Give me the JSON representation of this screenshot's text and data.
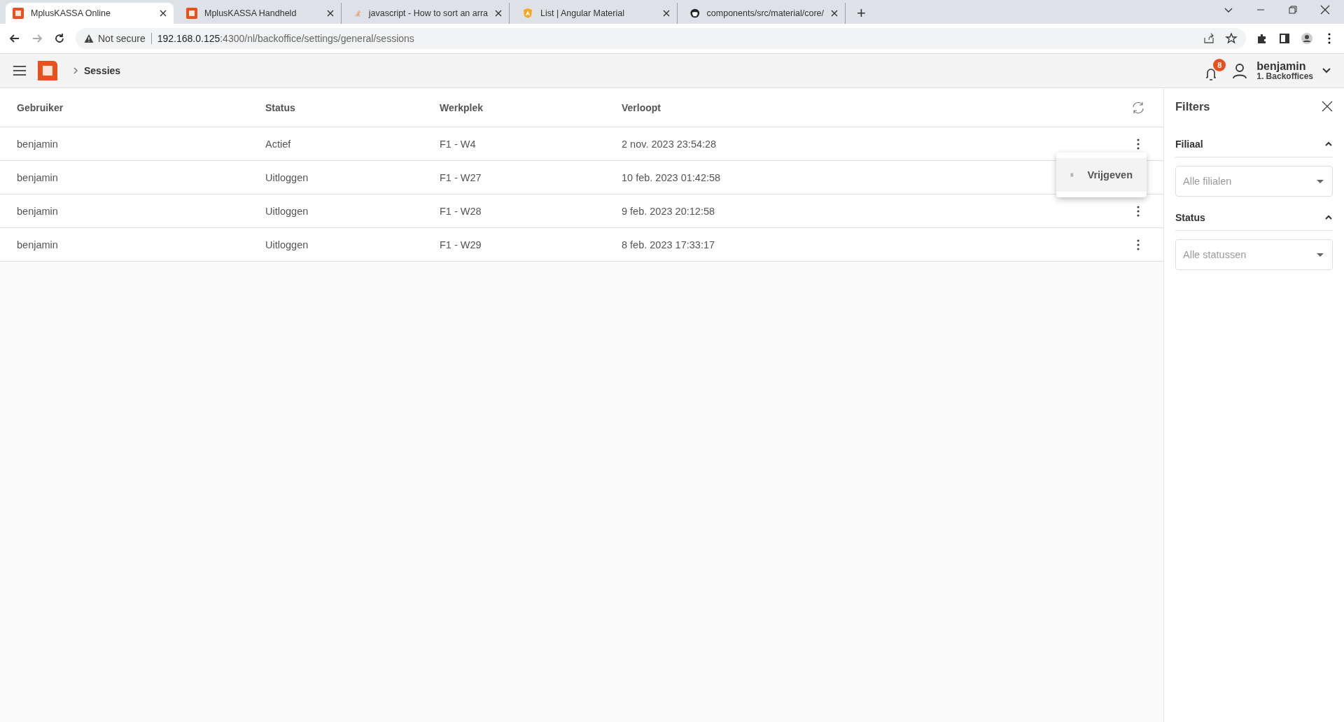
{
  "browser": {
    "tabs": [
      {
        "title": "MplusKASSA Online",
        "selected": true,
        "kind": "mplus"
      },
      {
        "title": "MplusKASSA Handheld",
        "selected": false,
        "kind": "mplus"
      },
      {
        "title": "javascript - How to sort an arra",
        "selected": false,
        "kind": "stack"
      },
      {
        "title": "List | Angular Material",
        "selected": false,
        "kind": "shield"
      },
      {
        "title": "components/src/material/core/",
        "selected": false,
        "kind": "github"
      }
    ],
    "new_tab": "+",
    "address": {
      "security": "Not secure",
      "host": "192.168.0.125",
      "path": ":4300/nl/backoffice/settings/general/sessions"
    }
  },
  "header": {
    "breadcrumb": "Sessies",
    "notifications": "8",
    "user": {
      "name": "benjamin",
      "location": "1. Backoffices"
    }
  },
  "table": {
    "columns": [
      "Gebruiker",
      "Status",
      "Werkplek",
      "Verloopt"
    ],
    "rows": [
      {
        "cells": [
          "benjamin",
          "Actief",
          "F1 - W4",
          "2 nov. 2023 23:54:28"
        ]
      },
      {
        "cells": [
          "benjamin",
          "Uitloggen",
          "F1 - W27",
          "10 feb. 2023 01:42:58"
        ]
      },
      {
        "cells": [
          "benjamin",
          "Uitloggen",
          "F1 - W28",
          "9 feb. 2023 20:12:58"
        ]
      },
      {
        "cells": [
          "benjamin",
          "Uitloggen",
          "F1 - W29",
          "8 feb. 2023 17:33:17"
        ]
      }
    ]
  },
  "row_menu": {
    "items": [
      {
        "label": "Vrijgeven"
      }
    ]
  },
  "filters": {
    "title": "Filters",
    "sections": [
      {
        "label": "Filiaal",
        "expanded": true,
        "placeholder": "Alle filialen"
      },
      {
        "label": "Status",
        "expanded": true,
        "placeholder": "Alle statussen"
      }
    ]
  }
}
